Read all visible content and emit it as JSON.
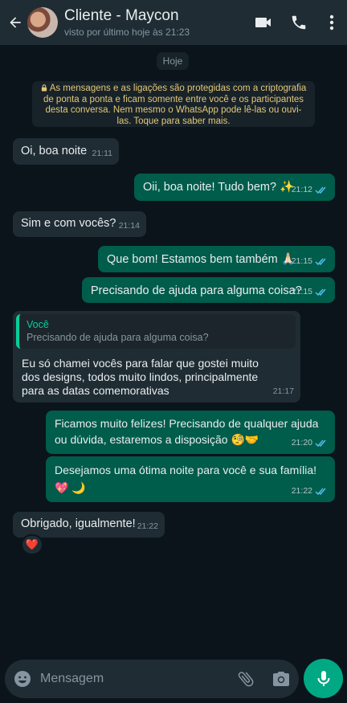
{
  "header": {
    "contact_name": "Cliente - Maycon",
    "last_seen": "visto por último hoje às 21:23",
    "icons": [
      "back-arrow-icon",
      "avatar",
      "video-call-icon",
      "phone-icon",
      "more-options-icon"
    ]
  },
  "chat": {
    "date_label": "Hoje",
    "encryption_notice": "As mensagens e as ligações são protegidas com a criptografia de ponta a ponta e ficam somente entre você e os participantes desta conversa. Nem mesmo o WhatsApp pode lê-las ou ouvi-las. Toque para saber mais.",
    "messages": [
      {
        "direction": "in",
        "text": "Oi, boa noite",
        "time": "21:11"
      },
      {
        "direction": "out",
        "text": "Oii, boa noite! Tudo bem? ✨",
        "time": "21:12",
        "status": "read"
      },
      {
        "direction": "in",
        "text": "Sim e com vocês?",
        "time": "21:14"
      },
      {
        "direction": "out",
        "text": "Que bom! Estamos bem também 🙏🏻",
        "time": "21:15",
        "status": "read"
      },
      {
        "direction": "out",
        "text": "Precisando de ajuda para alguma coisa?",
        "time": "21:15",
        "status": "read"
      },
      {
        "direction": "in",
        "quote_author": "Você",
        "quote_text": "Precisando de ajuda para alguma coisa?",
        "text": "Eu só chamei vocês para falar que gostei muito dos designs, todos muito lindos, principalmente para as datas comemorativas",
        "time": "21:17"
      },
      {
        "direction": "out",
        "text": "Ficamos muito felizes! Precisando de qualquer ajuda ou dúvida, estaremos a disposição 🧐🤝",
        "time": "21:20",
        "status": "read"
      },
      {
        "direction": "out",
        "text": "Desejamos uma ótima noite para você e sua família! 💖 🌙",
        "time": "21:22",
        "status": "read"
      },
      {
        "direction": "in",
        "text": "Obrigado, igualmente!",
        "time": "21:22",
        "reaction": "❤️"
      }
    ]
  },
  "composer": {
    "placeholder": "Mensagem",
    "icons": [
      "emoji-icon",
      "attach-icon",
      "camera-icon",
      "mic-icon"
    ]
  },
  "colors": {
    "background": "#0b141a",
    "header": "#1f2c34",
    "incoming_bubble": "#1f2c34",
    "outgoing_bubble": "#005c4b",
    "accent": "#00a884",
    "read_ticks": "#53bdeb"
  }
}
